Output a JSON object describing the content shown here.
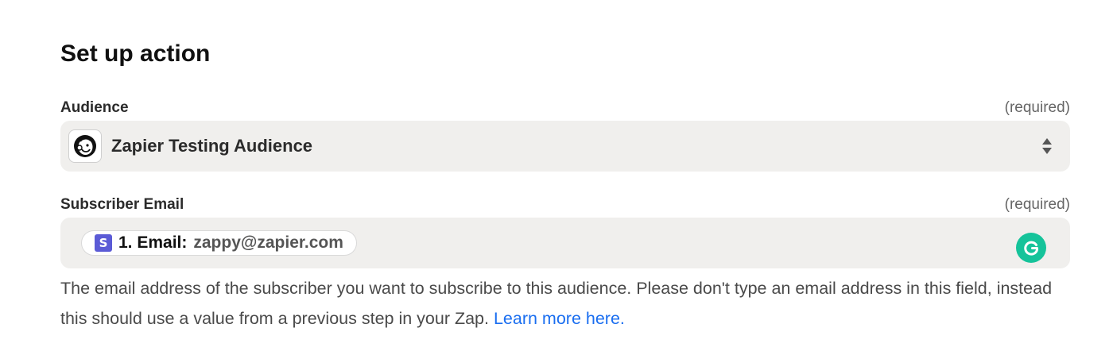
{
  "section": {
    "title": "Set up action"
  },
  "audience_field": {
    "label": "Audience",
    "required_hint": "(required)",
    "selected_value": "Zapier Testing Audience",
    "app_icon": "mailchimp-icon"
  },
  "email_field": {
    "label": "Subscriber Email",
    "required_hint": "(required)",
    "pill": {
      "step_icon_letter": "S",
      "step_icon_color": "#5b5bd6",
      "key": "1. Email:",
      "value": "zappy@zapier.com"
    },
    "extension_icon": "grammarly-icon",
    "help_text": "The email address of the subscriber you want to subscribe to this audience. Please don't type an email address in this field, instead this should use a value from a previous step in your Zap.",
    "help_link": "Learn more here."
  },
  "colors": {
    "field_background": "#f0efed",
    "link": "#1a6ef0",
    "grammarly": "#15c39a"
  }
}
